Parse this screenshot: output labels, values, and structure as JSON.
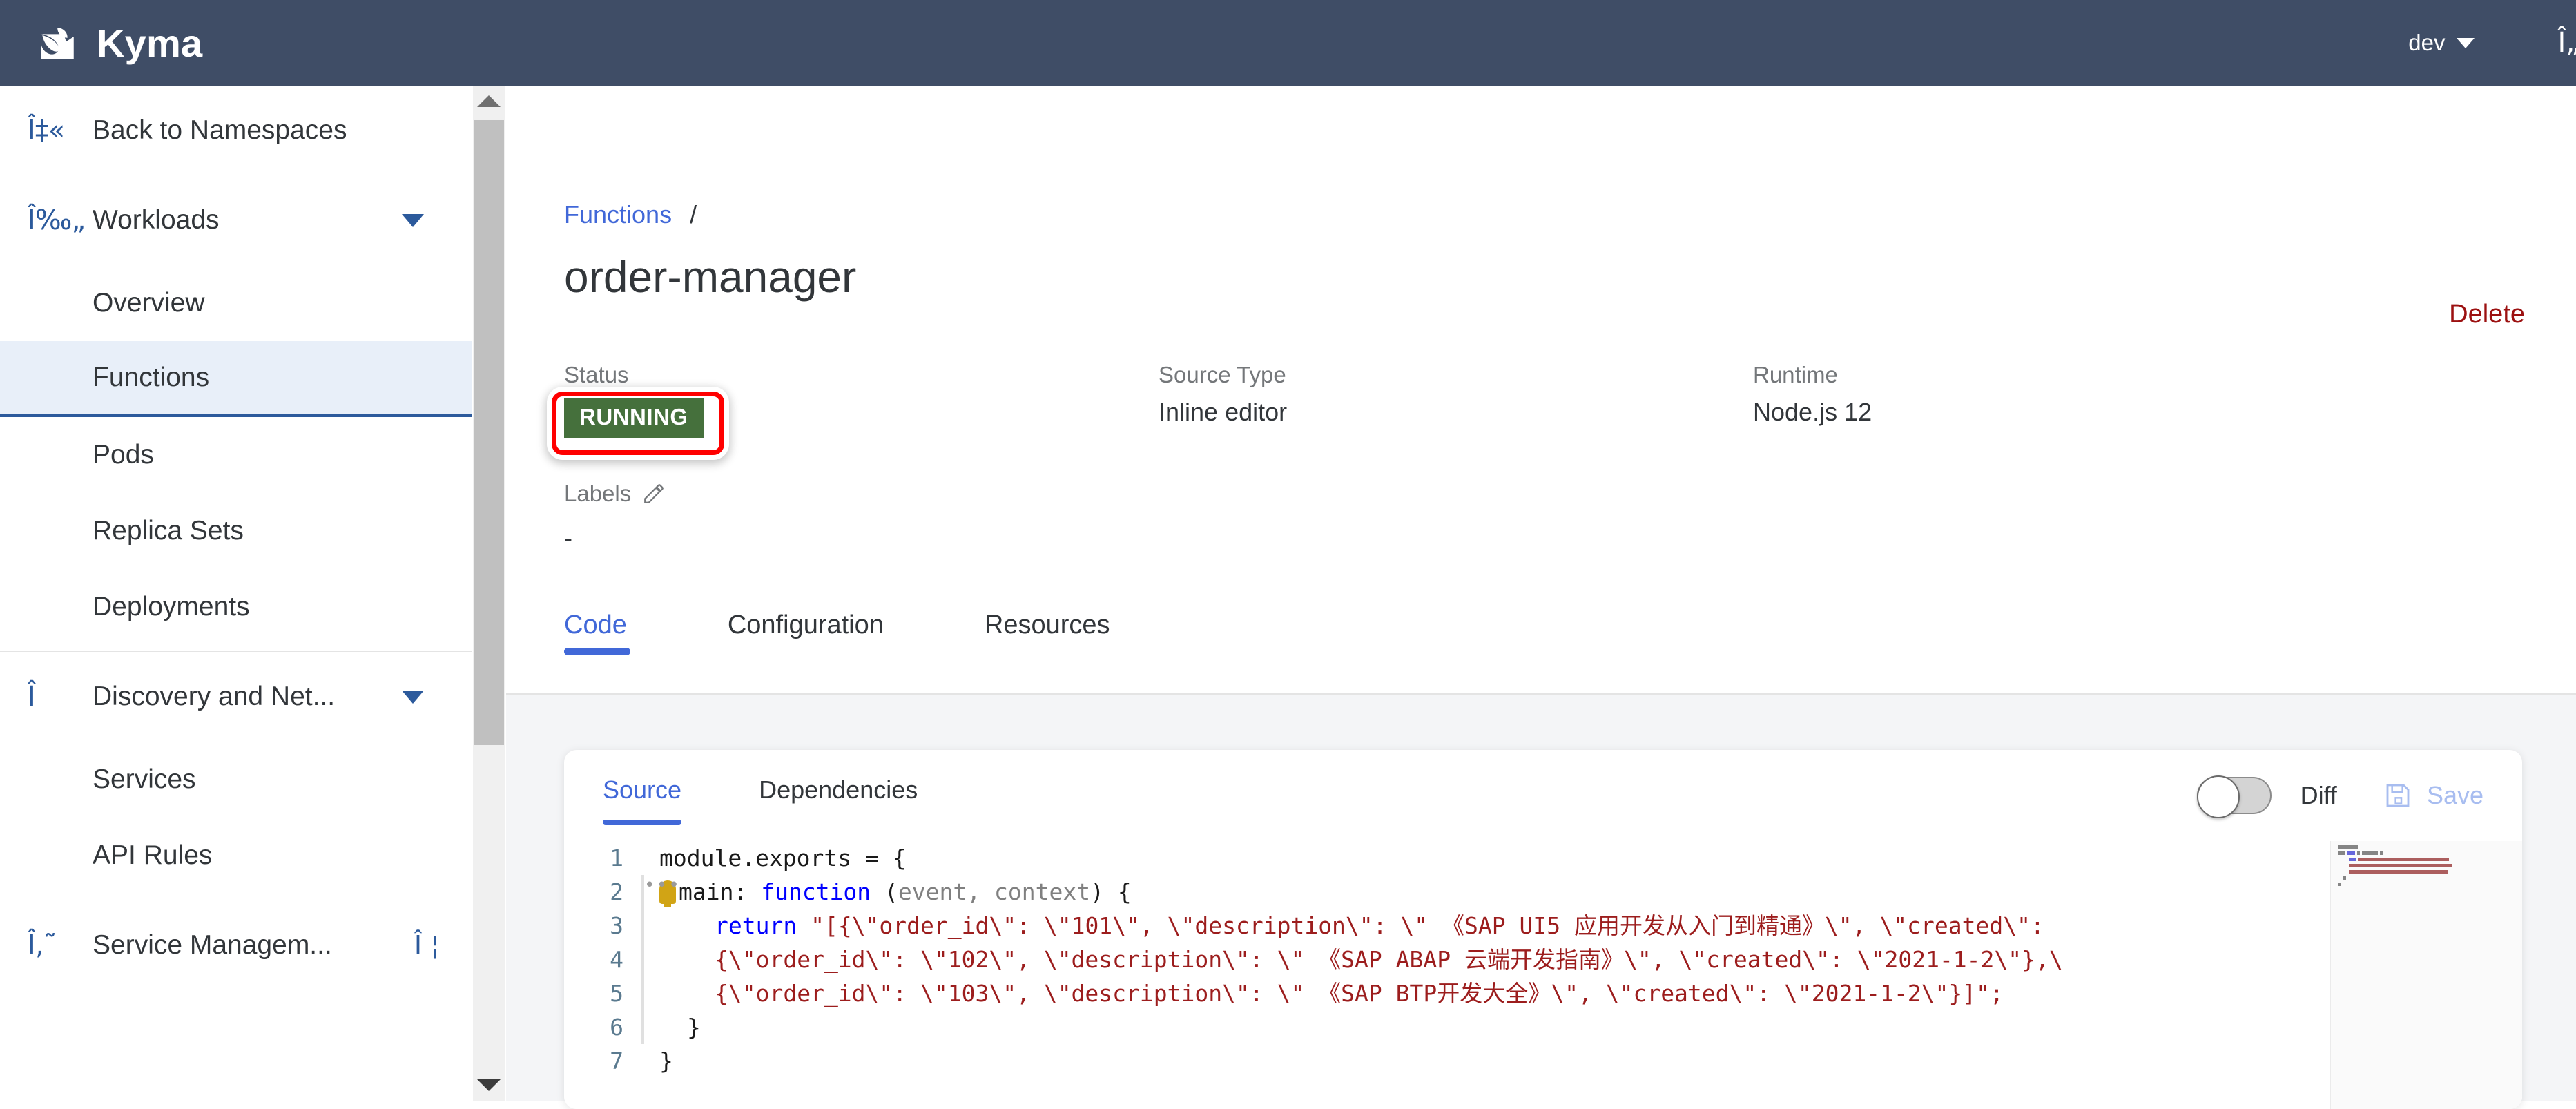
{
  "topbar": {
    "brand": "Kyma",
    "logo_icon": "kyma-logo-icon",
    "environment": "dev",
    "caret_icon": "chevron-down-icon",
    "right_icon_glyph": "Î„",
    "background_color": "#3f4d66"
  },
  "sidebar": {
    "back": {
      "label": "Back to Namespaces",
      "icon_glyph": "Î‡«"
    },
    "groups": [
      {
        "label": "Workloads",
        "icon_glyph": "Î‰„",
        "expanded": true,
        "items": [
          "Overview",
          "Functions",
          "Pods",
          "Replica Sets",
          "Deployments"
        ]
      },
      {
        "label": "Discovery and Net...",
        "icon_glyph": "Î",
        "expanded": true,
        "items": [
          "Services",
          "API Rules"
        ]
      },
      {
        "label": "Service Managem...",
        "icon_glyph": "Î‚˜",
        "expanded": false,
        "trailing_glyph": "Î ¦",
        "items": []
      }
    ],
    "active_item": "Functions",
    "scrollbar": {
      "up_arrow": "scroll-up-arrow",
      "down_arrow": "scroll-down-arrow"
    }
  },
  "main": {
    "breadcrumb": {
      "parent": "Functions",
      "separator": "/"
    },
    "title": "order-manager",
    "delete_label": "Delete",
    "delete_color": "#9c1111",
    "meta": [
      {
        "label": "Status",
        "value": "RUNNING"
      },
      {
        "label": "Source Type",
        "value": "Inline editor"
      },
      {
        "label": "Runtime",
        "value": "Node.js 12"
      }
    ],
    "status_badge": {
      "text": "RUNNING",
      "color": "#45703c",
      "highlight_color": "#ff0000"
    },
    "labels": {
      "title": "Labels",
      "edit_icon": "pencil-icon",
      "value": "-"
    },
    "tabs": [
      {
        "label": "Code",
        "active": true
      },
      {
        "label": "Configuration",
        "active": false
      },
      {
        "label": "Resources",
        "active": false
      }
    ]
  },
  "editor": {
    "subtabs": [
      {
        "label": "Source",
        "active": true
      },
      {
        "label": "Dependencies",
        "active": false
      }
    ],
    "diff_toggle": {
      "label": "Diff",
      "on": false
    },
    "save": {
      "label": "Save",
      "icon": "floppy-save-icon",
      "enabled": false,
      "color": "#a8bdf0"
    },
    "code_lines": [
      {
        "number": "1",
        "indent": 0,
        "guide": false,
        "bulb": false,
        "tokens": [
          {
            "t": "module.exports = {",
            "c": "plain"
          }
        ]
      },
      {
        "number": "2",
        "indent": 0,
        "guide": true,
        "bulb": true,
        "tokens": [
          {
            "t": "main: ",
            "c": "plain"
          },
          {
            "t": "function",
            "c": "kw"
          },
          {
            "t": " (",
            "c": "plain"
          },
          {
            "t": "event, context",
            "c": "param"
          },
          {
            "t": ") {",
            "c": "plain"
          }
        ]
      },
      {
        "number": "3",
        "indent": 2,
        "guide": true,
        "bulb": false,
        "tokens": [
          {
            "t": "return",
            "c": "kw"
          },
          {
            "t": " \"[{\\\"order_id\\\": \\\"101\\\", \\\"description\\\": \\\" 《SAP UI5 应用开发从入门到精通》\\\", \\\"created\\\":",
            "c": "str"
          }
        ]
      },
      {
        "number": "4",
        "indent": 2,
        "guide": true,
        "bulb": false,
        "tokens": [
          {
            "t": "{\\\"order_id\\\": \\\"102\\\", \\\"description\\\": \\\" 《SAP ABAP 云端开发指南》\\\", \\\"created\\\": \\\"2021-1-2\\\"},\\",
            "c": "str"
          }
        ]
      },
      {
        "number": "5",
        "indent": 2,
        "guide": true,
        "bulb": false,
        "tokens": [
          {
            "t": "{\\\"order_id\\\": \\\"103\\\", \\\"description\\\": \\\" 《SAP BTP开发大全》\\\", \\\"created\\\": \\\"2021-1-2\\\"}]\";",
            "c": "str"
          }
        ]
      },
      {
        "number": "6",
        "indent": 1,
        "guide": true,
        "bulb": false,
        "tokens": [
          {
            "t": "}",
            "c": "plain"
          }
        ]
      },
      {
        "number": "7",
        "indent": 0,
        "guide": false,
        "bulb": false,
        "tokens": [
          {
            "t": "}",
            "c": "plain"
          }
        ]
      }
    ]
  }
}
